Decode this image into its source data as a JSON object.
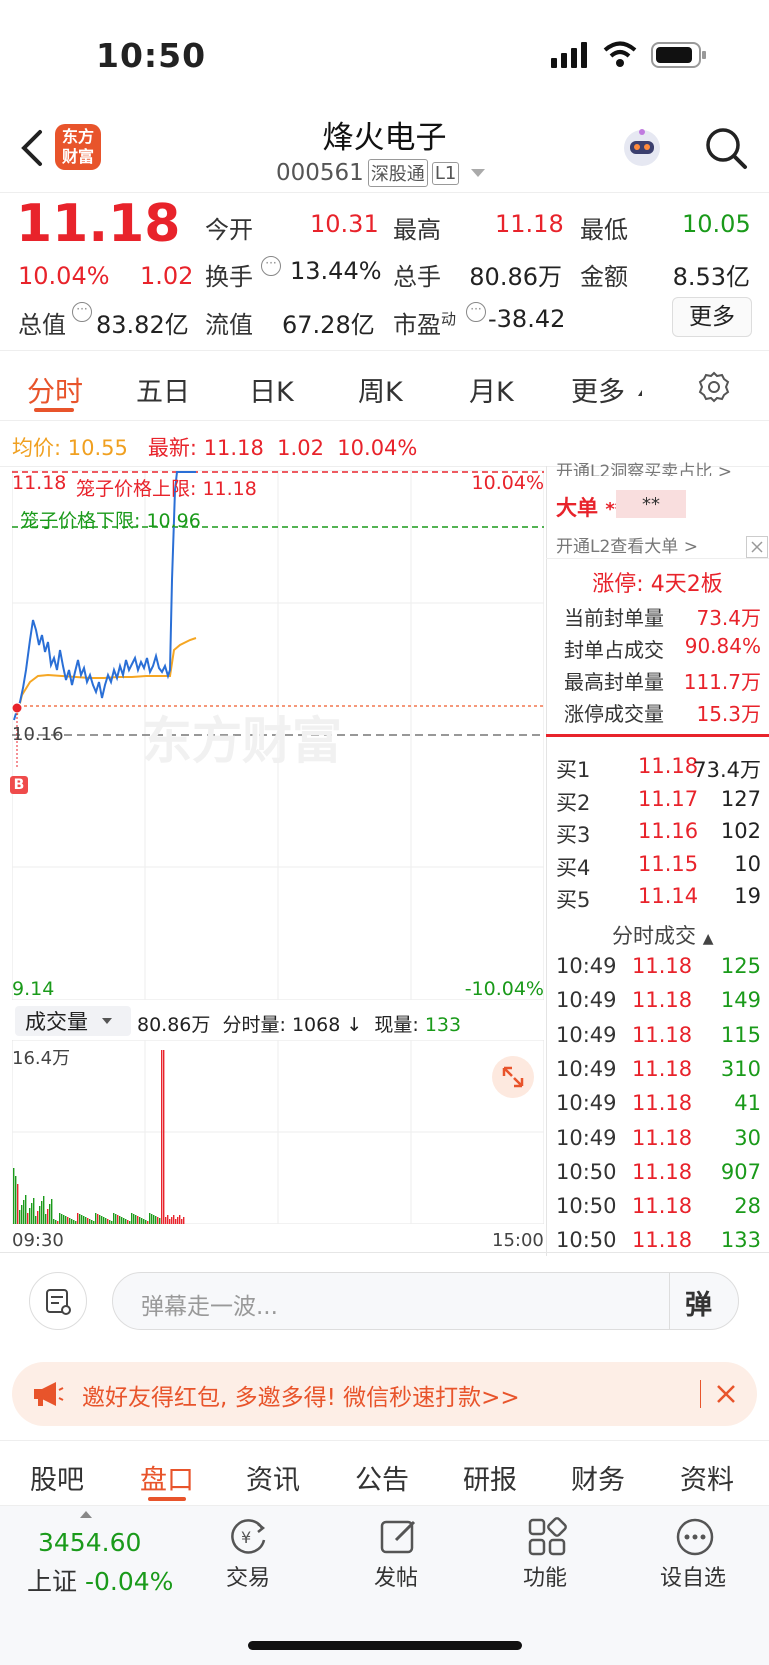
{
  "status_bar": {
    "time": "10:50"
  },
  "header": {
    "stock_name": "烽火电子",
    "stock_code": "000561",
    "tag_connect": "深股通",
    "tag_level": "L1",
    "logo_line1": "东方",
    "logo_line2": "财富"
  },
  "quote": {
    "price": "11.18",
    "change_pct": "10.04%",
    "change_amt": "1.02",
    "open_label": "今开",
    "open": "10.31",
    "high_label": "最高",
    "high": "11.18",
    "low_label": "最低",
    "low": "10.05",
    "turnover_label": "换手",
    "turnover": "13.44%",
    "volume_label": "总手",
    "volume": "80.86万",
    "amount_label": "金额",
    "amount": "8.53亿",
    "mktcap_label": "总值",
    "mktcap": "83.82亿",
    "float_label": "流值",
    "float": "67.28亿",
    "pe_label": "市盈",
    "pe_sup": "动",
    "pe": "-38.42",
    "more_button": "更多"
  },
  "chart_tabs": [
    "分时",
    "五日",
    "日K",
    "周K",
    "月K",
    "更多"
  ],
  "info_line": {
    "avg_label": "均价:",
    "avg": "10.55",
    "last_label": "最新:",
    "last": "11.18",
    "last_chg": "1.02",
    "last_pct": "10.04%"
  },
  "chart": {
    "top_price": "11.18",
    "top_pct": "10.04%",
    "upper_limit_label": "笼子价格上限: 11.18",
    "lower_limit_label": "笼子价格下限: 10.96",
    "prev_close": "10.16",
    "bottom_price": "9.14",
    "bottom_pct": "-10.04%",
    "buy_marker": "B",
    "watermark": "东方财富",
    "colors": {
      "price": "#2a6fd6",
      "avg": "#f5a623",
      "limit": "#e8232b",
      "lower": "#1a9a1a"
    }
  },
  "volume_panel": {
    "selector": "成交量",
    "total": "80.86万",
    "minute_label": "分时量:",
    "minute_value": "1068",
    "now_label": "现量:",
    "now_value": "133",
    "max_label": "16.4万",
    "time_start": "09:30",
    "time_end": "15:00"
  },
  "side_panel": {
    "l2_banner_1": "开通L2洞察买卖占比 >",
    "big_order_label": "大单",
    "big_order_stars1": "**",
    "big_order_stars2": "**",
    "l2_banner_2": "开通L2查看大单 >",
    "limit_up_title": "涨停: 4天2板",
    "seal_rows": [
      {
        "label": "当前封单量",
        "value": "73.4万"
      },
      {
        "label": "封单占成交",
        "value": "90.84%"
      },
      {
        "label": "最高封单量",
        "value": "111.7万"
      },
      {
        "label": "涨停成交量",
        "value": "15.3万"
      }
    ],
    "bids": [
      {
        "level": "买1",
        "price": "11.18",
        "qty": "73.4万"
      },
      {
        "level": "买2",
        "price": "11.17",
        "qty": "127"
      },
      {
        "level": "买3",
        "price": "11.16",
        "qty": "102"
      },
      {
        "level": "买4",
        "price": "11.15",
        "qty": "10"
      },
      {
        "level": "买5",
        "price": "11.14",
        "qty": "19"
      }
    ],
    "ticks_title": "分时成交",
    "ticks": [
      {
        "time": "10:49",
        "price": "11.18",
        "qty": "125"
      },
      {
        "time": "10:49",
        "price": "11.18",
        "qty": "149"
      },
      {
        "time": "10:49",
        "price": "11.18",
        "qty": "115"
      },
      {
        "time": "10:49",
        "price": "11.18",
        "qty": "310"
      },
      {
        "time": "10:49",
        "price": "11.18",
        "qty": "41"
      },
      {
        "time": "10:49",
        "price": "11.18",
        "qty": "30"
      },
      {
        "time": "10:50",
        "price": "11.18",
        "qty": "907"
      },
      {
        "time": "10:50",
        "price": "11.18",
        "qty": "28"
      },
      {
        "time": "10:50",
        "price": "11.18",
        "qty": "133"
      }
    ]
  },
  "danmaku": {
    "placeholder": "弹幕走一波...",
    "toggle": "弹"
  },
  "promo": {
    "text": "邀好友得红包, 多邀多得! 微信秒速打款>>"
  },
  "bottom_tabs": [
    "股吧",
    "盘口",
    "资讯",
    "公告",
    "研报",
    "财务",
    "资料"
  ],
  "bottom_nav": {
    "index_value": "3454.60",
    "index_name": "上证",
    "index_change": "-0.04%",
    "items": [
      "交易",
      "发帖",
      "功能",
      "设自选"
    ]
  }
}
